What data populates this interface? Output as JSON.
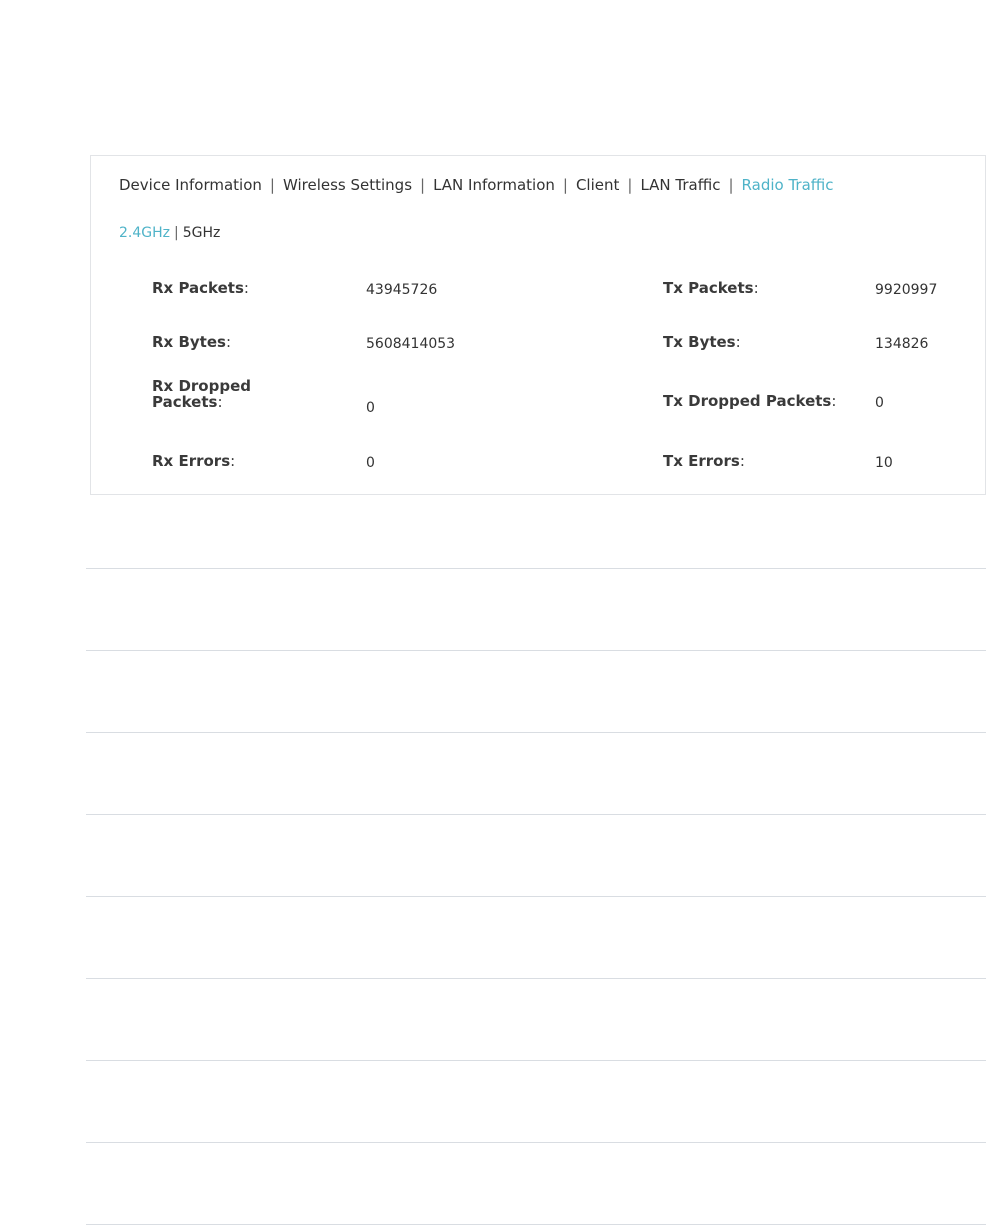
{
  "tabs": [
    {
      "label": "Device Information",
      "active": false
    },
    {
      "label": "Wireless Settings",
      "active": false
    },
    {
      "label": "LAN Information",
      "active": false
    },
    {
      "label": "Client",
      "active": false
    },
    {
      "label": "LAN Traffic",
      "active": false
    },
    {
      "label": "Radio Traffic",
      "active": true
    }
  ],
  "tab_separator": "|",
  "bands": {
    "items": [
      {
        "label": "2.4GHz",
        "active": true
      },
      {
        "label": "5GHz",
        "active": false
      }
    ],
    "separator": "|"
  },
  "stats": {
    "colon": ":",
    "rx_packets": {
      "label": "Rx Packets",
      "value": "43945726"
    },
    "rx_bytes": {
      "label": "Rx Bytes",
      "value": "5608414053"
    },
    "rx_dropped": {
      "label_line1": "Rx Dropped",
      "label_line2": "Packets",
      "value": "0"
    },
    "rx_errors": {
      "label": "Rx Errors",
      "value": "0"
    },
    "tx_packets": {
      "label": "Tx Packets",
      "value": "9920997"
    },
    "tx_bytes": {
      "label": "Tx Bytes",
      "value": "134826"
    },
    "tx_dropped": {
      "label": "Tx Dropped Packets",
      "value": "0"
    },
    "tx_errors": {
      "label": "Tx Errors",
      "value": "10"
    }
  },
  "colors": {
    "accent": "#4fb3c8",
    "text": "#333333",
    "border": "#e2e4e7",
    "divider": "#d9dde2"
  }
}
